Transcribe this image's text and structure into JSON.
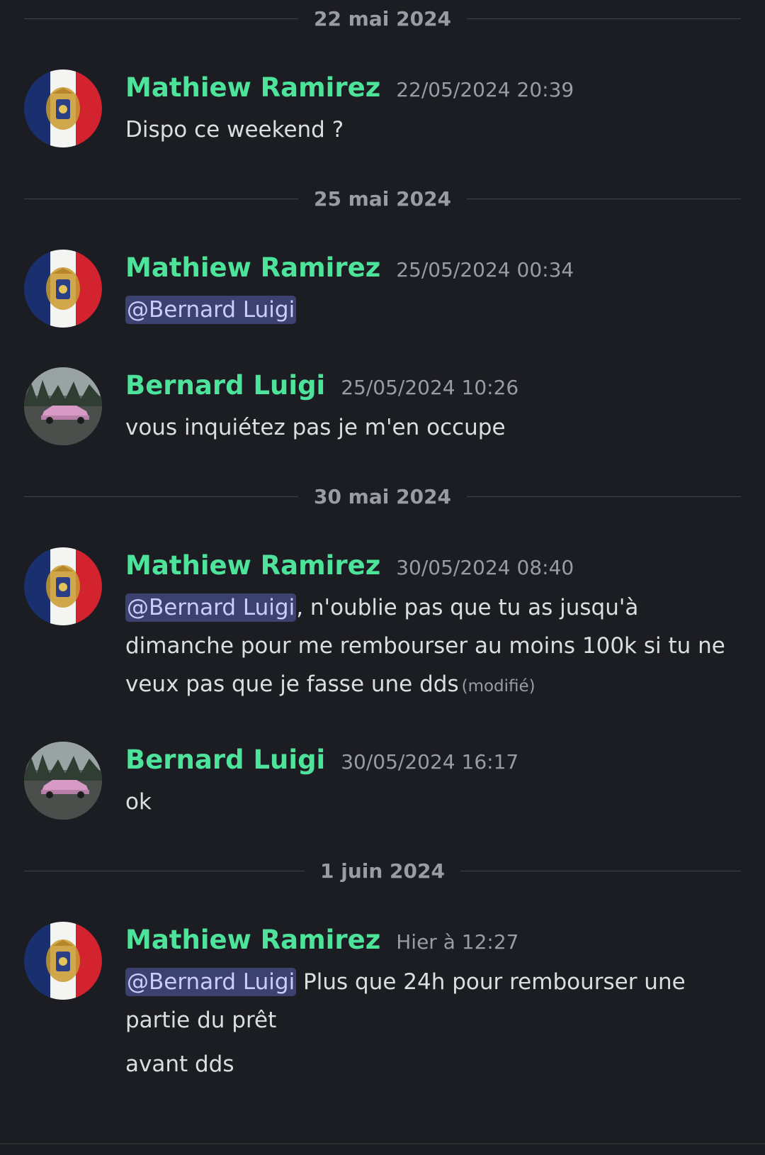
{
  "dividers": [
    "22 mai 2024",
    "25 mai 2024",
    "30 mai 2024",
    "1 juin 2024"
  ],
  "messages": [
    {
      "username": "Mathiew Ramirez",
      "timestamp": "22/05/2024 20:39",
      "text": "Dispo ce weekend ?",
      "avatar": "france-flag-coat-of-arms"
    },
    {
      "username": "Mathiew Ramirez",
      "timestamp": "25/05/2024 00:34",
      "mention": "@Bernard Luigi",
      "avatar": "france-flag-coat-of-arms"
    },
    {
      "username": "Bernard Luigi",
      "timestamp": "25/05/2024 10:26",
      "text": "vous inquiétez pas je m'en occupe",
      "avatar": "pink-car-forest"
    },
    {
      "username": "Mathiew Ramirez",
      "timestamp": "30/05/2024 08:40",
      "mention": "@Bernard Luigi",
      "text": ", n'oublie pas que tu as jusqu'à dimanche pour me rembourser au moins 100k si tu ne veux pas que je fasse une dds",
      "edited": "(modifié)",
      "avatar": "france-flag-coat-of-arms"
    },
    {
      "username": "Bernard Luigi",
      "timestamp": "30/05/2024 16:17",
      "text": "ok",
      "avatar": "pink-car-forest"
    },
    {
      "username": "Mathiew Ramirez",
      "timestamp": "Hier à 12:27",
      "mention": "@Bernard Luigi",
      "text": " Plus que 24h pour rembourser une partie du prêt",
      "text2": "avant dds",
      "avatar": "france-flag-coat-of-arms"
    }
  ],
  "colors": {
    "background": "#1c1d22",
    "username": "#4ee39b",
    "timestamp": "#9a9ca3",
    "mention_bg": "#3c4270",
    "mention_text": "#c9cdfb"
  }
}
